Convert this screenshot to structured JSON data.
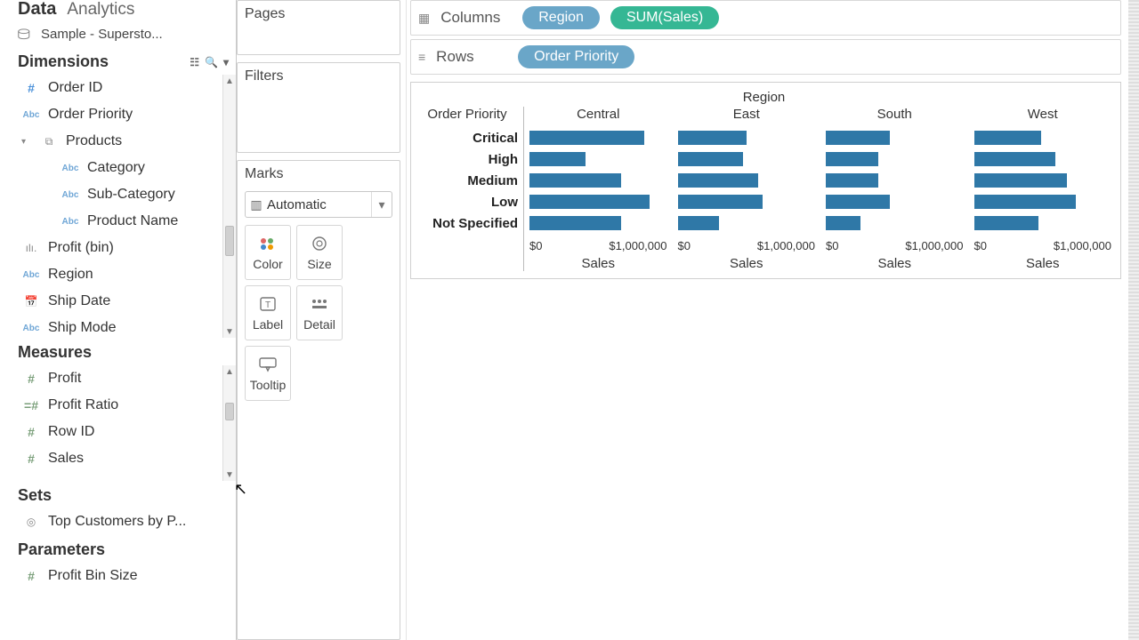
{
  "sidebar": {
    "tab_data": "Data",
    "tab_analytics": "Analytics",
    "datasource": "Sample - Supersto...",
    "dimensions_header": "Dimensions",
    "measures_header": "Measures",
    "sets_header": "Sets",
    "parameters_header": "Parameters",
    "dimensions": {
      "order_id": "Order ID",
      "order_priority": "Order Priority",
      "products": "Products",
      "category": "Category",
      "sub_category": "Sub-Category",
      "product_name": "Product Name",
      "profit_bin": "Profit (bin)",
      "region": "Region",
      "ship_date": "Ship Date",
      "ship_mode": "Ship Mode"
    },
    "measures": {
      "profit": "Profit",
      "profit_ratio": "Profit Ratio",
      "row_id": "Row ID",
      "sales": "Sales"
    },
    "sets": {
      "top_customers": "Top Customers by P..."
    },
    "parameters": {
      "profit_bin_size": "Profit Bin Size"
    }
  },
  "shelves": {
    "pages": "Pages",
    "filters": "Filters",
    "marks": "Marks",
    "mark_type": "Automatic",
    "buttons": {
      "color": "Color",
      "size": "Size",
      "label": "Label",
      "detail": "Detail",
      "tooltip": "Tooltip"
    }
  },
  "rows_cols": {
    "columns_label": "Columns",
    "rows_label": "Rows",
    "pill_region": "Region",
    "pill_sum_sales": "SUM(Sales)",
    "pill_order_priority": "Order Priority"
  },
  "chart_data": {
    "type": "bar",
    "title": "Region",
    "row_field": "Order Priority",
    "col_field_label": "Sales",
    "x_ticks": [
      "$0",
      "$1,000,000"
    ],
    "xlim_max": 1200000,
    "columns": [
      "Central",
      "East",
      "South",
      "West"
    ],
    "rows": [
      "Critical",
      "High",
      "Medium",
      "Low",
      "Not Specified"
    ],
    "values": {
      "Central": [
        1000000,
        490000,
        800000,
        1050000,
        800000
      ],
      "East": [
        600000,
        570000,
        700000,
        740000,
        360000
      ],
      "South": [
        560000,
        460000,
        460000,
        560000,
        300000
      ],
      "West": [
        590000,
        710000,
        810000,
        890000,
        560000
      ]
    }
  }
}
